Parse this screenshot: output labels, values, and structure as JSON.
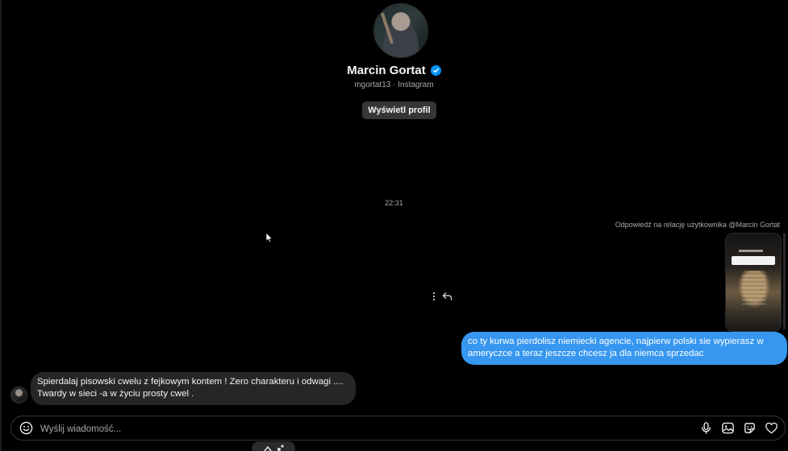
{
  "profile": {
    "name": "Marcin Gortat",
    "verified": true,
    "subtitle": "mgortat13 · Instagram",
    "view_profile_label": "Wyświetl profil"
  },
  "conversation": {
    "timestamp": "22:31",
    "story_reply_context": "Odpowiedź na relację użytkownika @Marcin Gortat",
    "messages": [
      {
        "direction": "outgoing",
        "text": "co ty kurwa pierdolisz niemiecki agencie, najpierw polski sie wypierasz w ameryczce a teraz jeszcze chcesz ja dla niemca sprzedac"
      },
      {
        "direction": "incoming",
        "text": "Spierdalaj pisowski cwelu z fejkowym kontem ! Zero charakteru i odwagi .... Twardy w sieci -a w życiu prosty cwel ."
      }
    ]
  },
  "composer": {
    "placeholder": "Wyślij wiadomość..."
  },
  "icons": {
    "more": "more-options-icon",
    "reply": "reply-icon",
    "emoji": "emoji-icon",
    "mic": "microphone-icon",
    "image": "image-icon",
    "sticker": "sticker-icon",
    "like": "heart-icon"
  },
  "colors": {
    "background": "#000000",
    "outgoing_bubble": "#3797f0",
    "incoming_bubble": "#262626",
    "verified": "#0095f6",
    "secondary_text": "#a8a8a8"
  }
}
